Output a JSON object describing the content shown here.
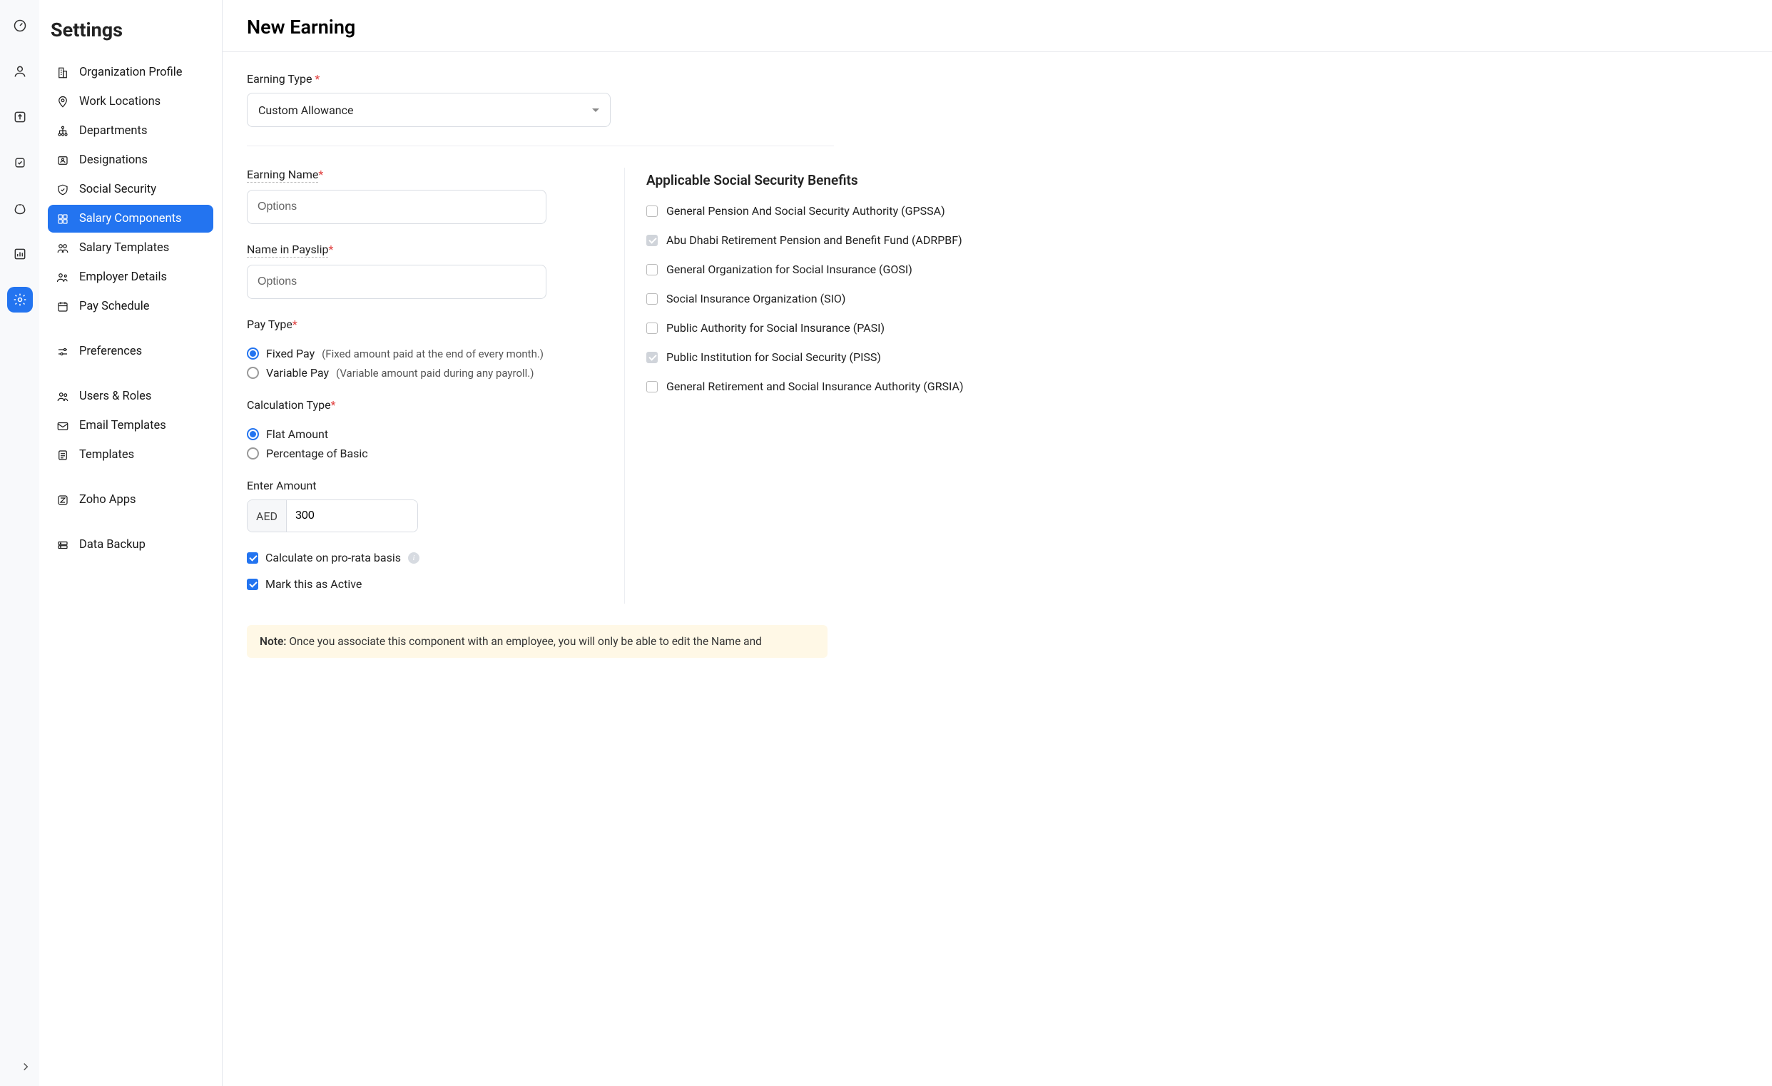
{
  "rail": {
    "icons": [
      "speedometer",
      "person",
      "arrow-out",
      "checkbox",
      "moneybag",
      "chart",
      "gear"
    ]
  },
  "sidebar": {
    "title": "Settings",
    "items": [
      {
        "label": "Organization Profile",
        "icon": "building"
      },
      {
        "label": "Work Locations",
        "icon": "pin"
      },
      {
        "label": "Departments",
        "icon": "tree"
      },
      {
        "label": "Designations",
        "icon": "id-card"
      },
      {
        "label": "Social Security",
        "icon": "shield"
      },
      {
        "label": "Salary Components",
        "icon": "components",
        "active": true
      },
      {
        "label": "Salary Templates",
        "icon": "template"
      },
      {
        "label": "Employer Details",
        "icon": "employer"
      },
      {
        "label": "Pay Schedule",
        "icon": "calendar"
      },
      {
        "label": "Preferences",
        "icon": "sliders"
      },
      {
        "label": "Users & Roles",
        "icon": "users"
      },
      {
        "label": "Email Templates",
        "icon": "mail"
      },
      {
        "label": "Templates",
        "icon": "doc"
      },
      {
        "label": "Zoho Apps",
        "icon": "z-apps"
      },
      {
        "label": "Data Backup",
        "icon": "backup"
      }
    ]
  },
  "page": {
    "title": "New Earning",
    "earning_type_label": "Earning Type",
    "earning_type_value": "Custom Allowance",
    "earning_name_label": "Earning Name",
    "earning_name_placeholder": "Options",
    "payslip_name_label": "Name in Payslip",
    "payslip_name_placeholder": "Options",
    "pay_type_label": "Pay Type",
    "pay_type_options": [
      {
        "label": "Fixed Pay",
        "hint": "(Fixed amount paid at the end of every month.)",
        "checked": true
      },
      {
        "label": "Variable Pay",
        "hint": "(Variable amount paid during any payroll.)",
        "checked": false
      }
    ],
    "calc_type_label": "Calculation Type",
    "calc_type_options": [
      {
        "label": "Flat Amount",
        "checked": true
      },
      {
        "label": "Percentage of Basic",
        "checked": false
      }
    ],
    "amount_label": "Enter Amount",
    "amount_currency": "AED",
    "amount_value": "300",
    "prorata_label": "Calculate on pro-rata basis",
    "prorata_checked": true,
    "active_label": "Mark this as Active",
    "active_checked": true,
    "benefits_title": "Applicable Social Security Benefits",
    "benefits": [
      {
        "label": "General Pension And Social Security Authority (GPSSA)",
        "state": "unchecked"
      },
      {
        "label": "Abu Dhabi Retirement Pension and Benefit Fund (ADRPBF)",
        "state": "locked"
      },
      {
        "label": "General Organization for Social Insurance (GOSI)",
        "state": "unchecked"
      },
      {
        "label": "Social Insurance Organization (SIO)",
        "state": "unchecked"
      },
      {
        "label": "Public Authority for Social Insurance (PASI)",
        "state": "unchecked"
      },
      {
        "label": "Public Institution for Social Security (PISS)",
        "state": "locked"
      },
      {
        "label": "General Retirement and Social Insurance Authority (GRSIA)",
        "state": "unchecked"
      }
    ],
    "note_prefix": "Note:",
    "note_text": " Once you associate this component with an employee, you will only be able to edit the Name and"
  }
}
